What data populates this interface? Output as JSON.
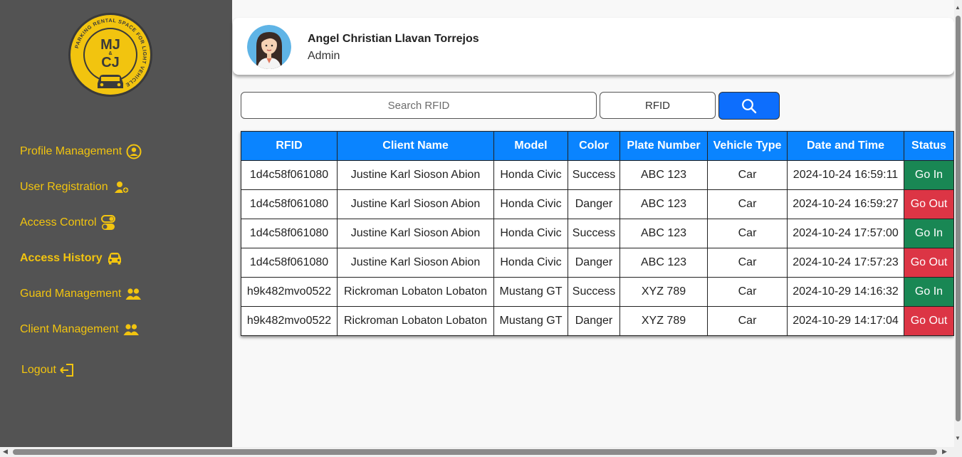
{
  "logo": {
    "letters_top": "MJ",
    "letters_amp": "&",
    "letters_bottom": "CJ",
    "ring_text": "PARKING RENTAL SPACE FOR LIGHT VEHICLE",
    "colors": {
      "gold": "#f2c40f",
      "dark": "#3a3a3a"
    }
  },
  "sidebar": {
    "items": [
      {
        "label": "Profile Management",
        "icon": "user-circle-icon",
        "active": false
      },
      {
        "label": "User Registration",
        "icon": "user-plus-icon",
        "active": false
      },
      {
        "label": "Access Control",
        "icon": "toggle-icon",
        "active": false
      },
      {
        "label": "Access History",
        "icon": "car-icon",
        "active": true
      },
      {
        "label": "Guard Management",
        "icon": "users-icon",
        "active": false
      },
      {
        "label": "Client Management",
        "icon": "users-icon",
        "active": false
      },
      {
        "label": "Logout",
        "icon": "logout-icon",
        "active": false
      }
    ]
  },
  "profile": {
    "name": "Angel Christian Llavan Torrejos",
    "role": "Admin"
  },
  "search": {
    "placeholder": "Search RFID",
    "value": "",
    "filter_selected": "RFID",
    "button_icon": "search-icon"
  },
  "table": {
    "headers": [
      "RFID",
      "Client Name",
      "Model",
      "Color",
      "Plate Number",
      "Vehicle Type",
      "Date and Time",
      "Status"
    ],
    "rows": [
      [
        "1d4c58f061080",
        "Justine Karl Sioson Abion",
        "Honda Civic",
        "Success",
        "ABC 123",
        "Car",
        "2024-10-24 16:59:11",
        "Go In"
      ],
      [
        "1d4c58f061080",
        "Justine Karl Sioson Abion",
        "Honda Civic",
        "Danger",
        "ABC 123",
        "Car",
        "2024-10-24 16:59:27",
        "Go Out"
      ],
      [
        "1d4c58f061080",
        "Justine Karl Sioson Abion",
        "Honda Civic",
        "Success",
        "ABC 123",
        "Car",
        "2024-10-24 17:57:00",
        "Go In"
      ],
      [
        "1d4c58f061080",
        "Justine Karl Sioson Abion",
        "Honda Civic",
        "Danger",
        "ABC 123",
        "Car",
        "2024-10-24 17:57:23",
        "Go Out"
      ],
      [
        "h9k482mvo0522",
        "Rickroman Lobaton Lobaton",
        "Mustang GT",
        "Success",
        "XYZ 789",
        "Car",
        "2024-10-29 14:16:32",
        "Go In"
      ],
      [
        "h9k482mvo0522",
        "Rickroman Lobaton Lobaton",
        "Mustang GT",
        "Danger",
        "XYZ 789",
        "Car",
        "2024-10-29 14:17:04",
        "Go Out"
      ]
    ]
  },
  "colors": {
    "sidebar_bg": "#535353",
    "nav_text": "#f2c40f",
    "header_blue": "#0a84ff",
    "button_blue": "#0d6efd",
    "go_in": "#198754",
    "go_out": "#dc3545"
  }
}
